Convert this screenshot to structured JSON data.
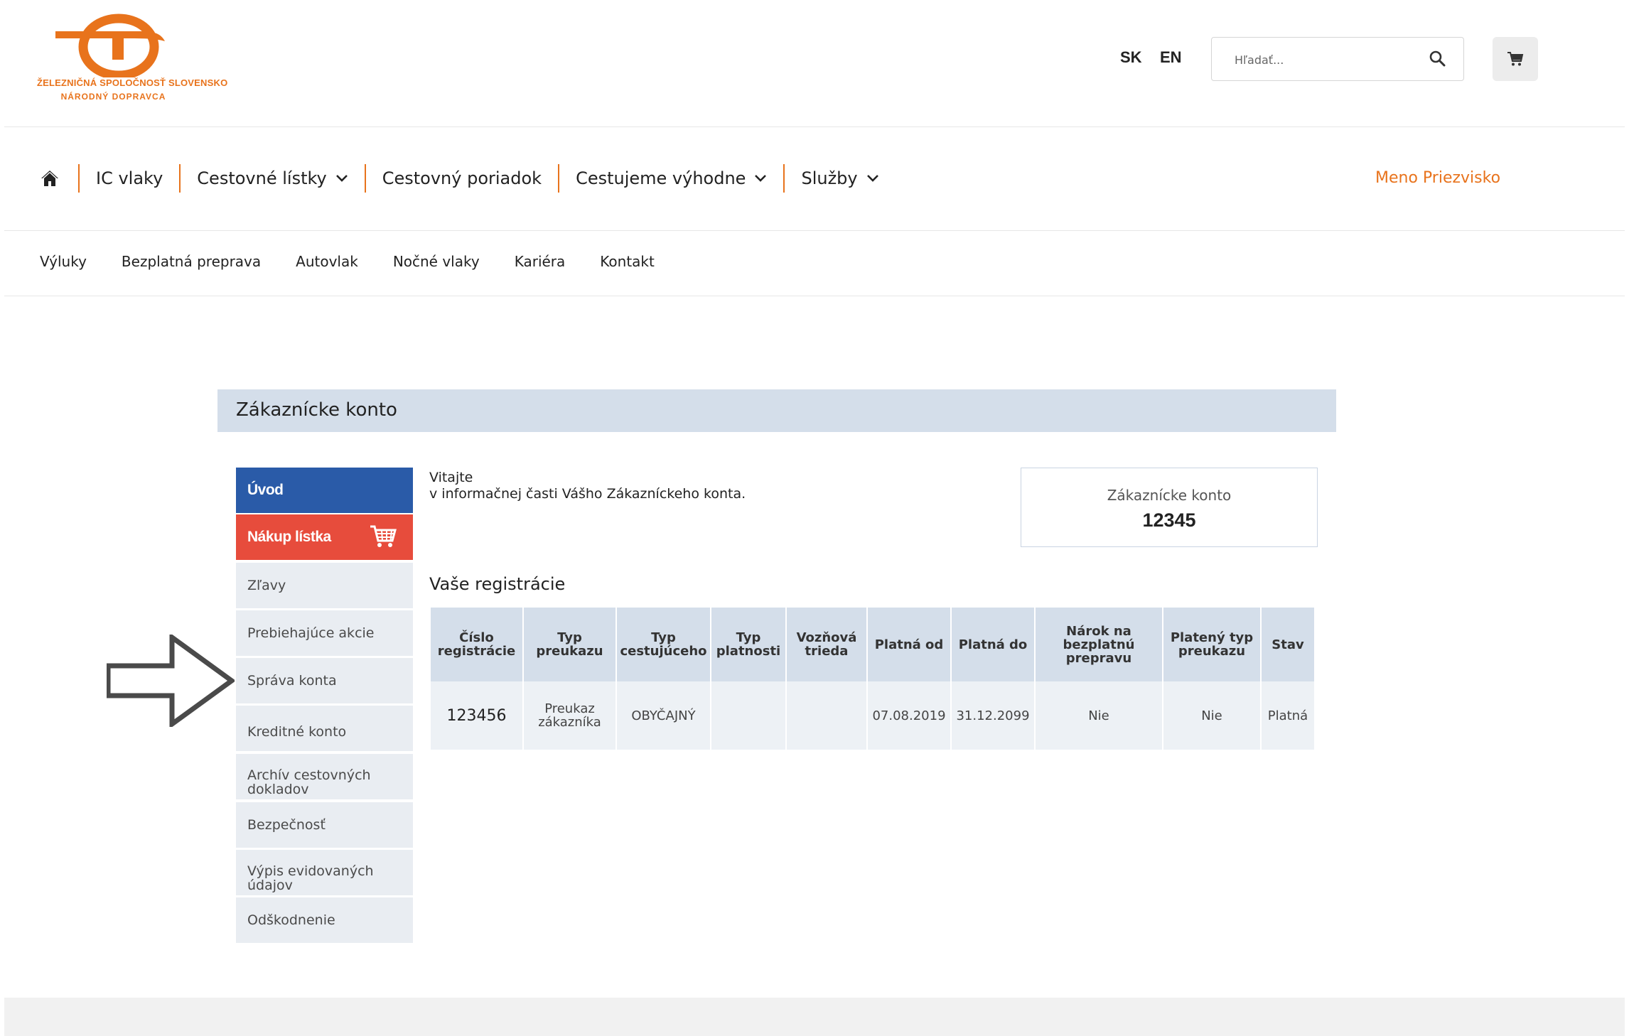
{
  "header": {
    "logo": {
      "line1": "ŽELEZNIČNÁ SPOLOČNOSŤ SLOVENSKO",
      "line2": "NÁRODNÝ DOPRAVCA",
      "color": "#e8731c"
    },
    "languages": [
      "SK",
      "EN"
    ],
    "search": {
      "placeholder": "Hľadať...",
      "icon": "search-icon"
    },
    "cart_icon": "cart-icon"
  },
  "main_nav": {
    "home_icon": "home-icon",
    "items": [
      {
        "label": "IC vlaky",
        "dropdown": false
      },
      {
        "label": "Cestovné lístky",
        "dropdown": true
      },
      {
        "label": "Cestovný poriadok",
        "dropdown": false
      },
      {
        "label": "Cestujeme výhodne",
        "dropdown": true
      },
      {
        "label": "Služby",
        "dropdown": true
      }
    ],
    "user_name": "Meno Priezvisko",
    "accent_color": "#e8731c"
  },
  "sub_nav": {
    "items": [
      "Výluky",
      "Bezplatná preprava",
      "Autovlak",
      "Nočné vlaky",
      "Kariéra",
      "Kontakt"
    ]
  },
  "account": {
    "title": "Zákaznícke konto",
    "menu": [
      {
        "label": "Úvod",
        "active": true,
        "color": "#2a5ba8"
      },
      {
        "label": "Nákup lístka",
        "icon": "cart-icon",
        "color": "#e74c3c"
      },
      {
        "label": "Zľavy"
      },
      {
        "label": "Prebiehajúce akcie"
      },
      {
        "label": "Správa konta"
      },
      {
        "label": "Kreditné konto"
      },
      {
        "label": "Archív cestovných dokladov"
      },
      {
        "label": "Bezpečnosť"
      },
      {
        "label": "Výpis evidovaných údajov"
      },
      {
        "label": "Odškodnenie"
      }
    ],
    "welcome_line1": "Vitajte",
    "welcome_line2": "v informačnej časti Vášho Zákazníckeho konta.",
    "account_box": {
      "label": "Zákaznícke konto",
      "number": "12345"
    },
    "registrations": {
      "heading": "Vaše registrácie",
      "columns": [
        "Číslo registrácie",
        "Typ preukazu",
        "Typ cestujúceho",
        "Typ platnosti",
        "Vozňová trieda",
        "Platná od",
        "Platná do",
        "Nárok na bezplatnú prepravu",
        "Platený typ preukazu",
        "Stav"
      ],
      "rows": [
        [
          "123456",
          "Preukaz zákazníka",
          "OBYČAJNÝ",
          "",
          "",
          "07.08.2019",
          "31.12.2099",
          "Nie",
          "Nie",
          "Platná"
        ]
      ]
    }
  }
}
